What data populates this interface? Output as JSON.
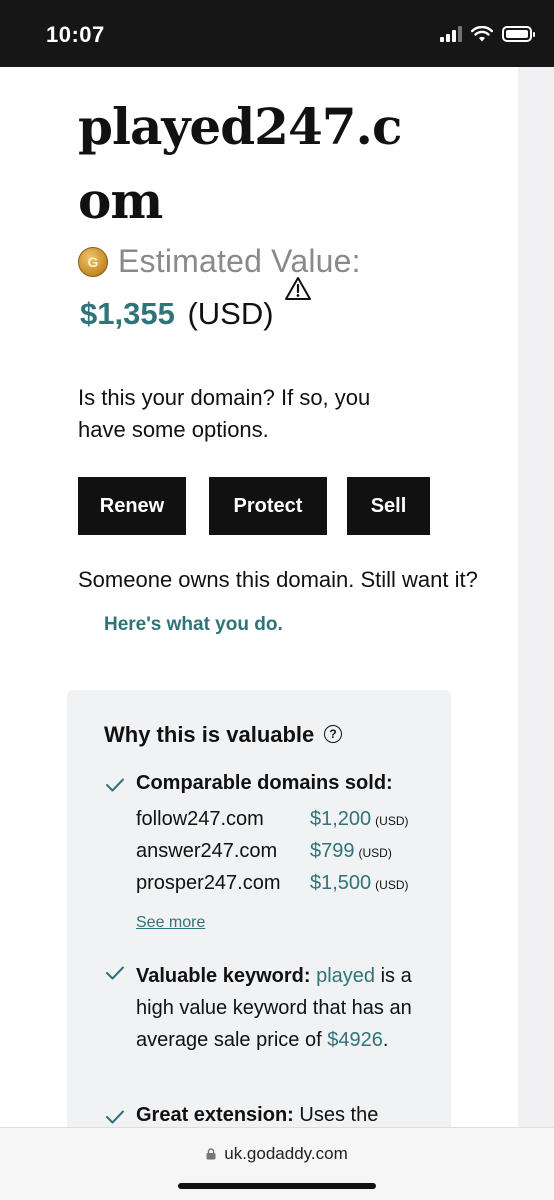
{
  "status_bar": {
    "time": "10:07"
  },
  "domain": {
    "title": "played247.com"
  },
  "estimate": {
    "label": "Estimated Value:",
    "price": "$1,355",
    "currency": "(USD)"
  },
  "intro": {
    "text": "Is this your domain? If so, you have some options."
  },
  "actions": {
    "renew": "Renew",
    "protect": "Protect",
    "sell": "Sell"
  },
  "owned": {
    "text": "Someone owns this domain. Still want it?",
    "link": "Here's what you do."
  },
  "valuable": {
    "title": "Why this is valuable",
    "comparable": {
      "label": "Comparable domains sold:",
      "items": [
        {
          "domain": "follow247.com",
          "price": "$1,200",
          "currency": "(USD)"
        },
        {
          "domain": "answer247.com",
          "price": "$799",
          "currency": "(USD)"
        },
        {
          "domain": "prosper247.com",
          "price": "$1,500",
          "currency": "(USD)"
        }
      ],
      "see_more": "See more"
    },
    "keyword": {
      "label": "Valuable keyword:",
      "word": "played",
      "text_mid": "is a high value keyword that has an average sale price of",
      "price": "$4926",
      "suffix": "."
    },
    "extension": {
      "label": "Great extension:",
      "text": "Uses the"
    }
  },
  "url_bar": {
    "url": "uk.godaddy.com"
  }
}
